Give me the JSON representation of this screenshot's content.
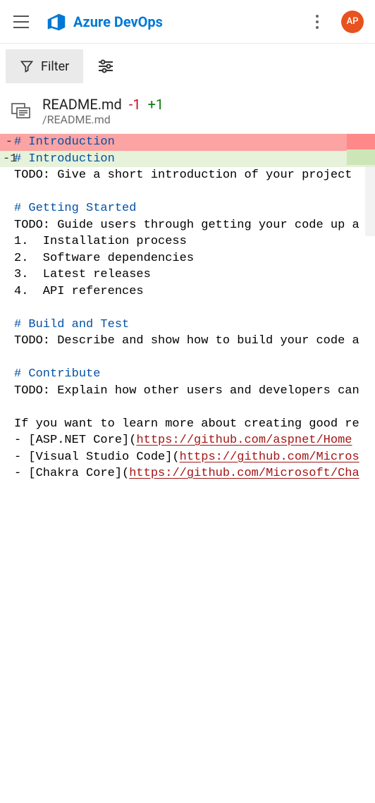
{
  "header": {
    "brand": "Azure DevOps",
    "avatar": "AP"
  },
  "toolbar": {
    "filter_label": "Filter"
  },
  "file": {
    "name": "README.md",
    "minus": "-1",
    "plus": "+1",
    "path": "/README.md"
  },
  "code": {
    "removed_gutter": "-",
    "removed_text": "# Introduction",
    "added_gutter": "-1",
    "added_text": "# Introduction",
    "l3": "TODO: Give a short introduction of your project",
    "h2": "# Getting Started",
    "l5": "TODO: Guide users through getting your code up a",
    "li1": "1.  Installation process",
    "li2": "2.  Software dependencies",
    "li3": "3.  Latest releases",
    "li4": "4.  API references",
    "h3": "# Build and Test",
    "l11": "TODO: Describe and show how to build your code a",
    "h4": "# Contribute",
    "l13": "TODO: Explain how other users and developers can",
    "l15": "If you want to learn more about creating good re",
    "link1_pre": "- [ASP.NET Core](",
    "link1_url": "https://github.com/aspnet/Home",
    "link2_pre": "- [Visual Studio Code](",
    "link2_url": "https://github.com/Micros",
    "link3_pre": "- [Chakra Core](",
    "link3_url": "https://github.com/Microsoft/Cha"
  }
}
